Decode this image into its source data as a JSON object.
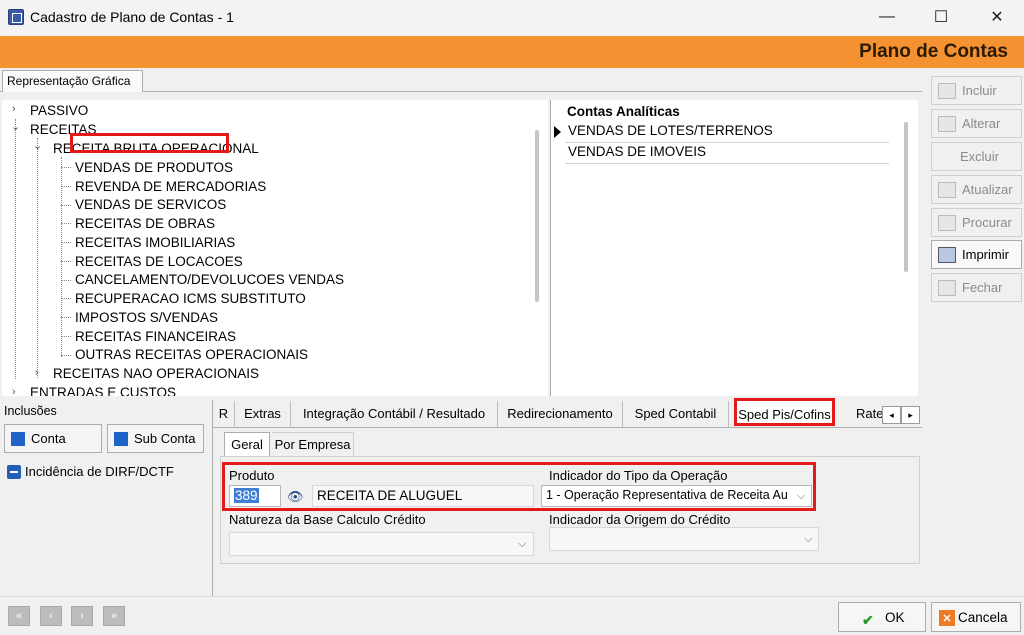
{
  "window": {
    "title": "Cadastro de Plano de Contas - 1",
    "minimize": "—",
    "maximize": "☐",
    "close": "✕"
  },
  "header": {
    "title": "Plano de Contas"
  },
  "top_tab": "Representação Gráfica",
  "tree": {
    "items": [
      {
        "label": "PASSIVO",
        "expander": "›"
      },
      {
        "label": "RECEITAS",
        "expander": "⌄"
      },
      {
        "label": "RECEITA BRUTA OPERACIONAL",
        "expander": "⌄"
      },
      {
        "label": "VENDAS DE PRODUTOS"
      },
      {
        "label": "REVENDA DE MERCADORIAS"
      },
      {
        "label": "VENDAS DE SERVICOS"
      },
      {
        "label": "RECEITAS DE OBRAS"
      },
      {
        "label": "RECEITAS IMOBILIARIAS"
      },
      {
        "label": "RECEITAS DE LOCACOES"
      },
      {
        "label": "CANCELAMENTO/DEVOLUCOES VENDAS"
      },
      {
        "label": "RECUPERACAO ICMS SUBSTITUTO"
      },
      {
        "label": "IMPOSTOS S/VENDAS"
      },
      {
        "label": "RECEITAS FINANCEIRAS"
      },
      {
        "label": "OUTRAS RECEITAS OPERACIONAIS"
      },
      {
        "label": "RECEITAS NAO OPERACIONAIS",
        "expander": "›"
      },
      {
        "label": "ENTRADAS E CUSTOS",
        "expander": "›"
      }
    ]
  },
  "grid": {
    "header": "Contas Analíticas",
    "rows": [
      "VENDAS DE LOTES/TERRENOS",
      "VENDAS DE IMOVEIS"
    ]
  },
  "side_buttons": [
    {
      "label": "Incluir",
      "enabled": false
    },
    {
      "label": "Alterar",
      "enabled": false
    },
    {
      "label": "Excluir",
      "enabled": false
    },
    {
      "label": "Atualizar",
      "enabled": false
    },
    {
      "label": "Procurar",
      "enabled": false
    },
    {
      "label": "Imprimir",
      "enabled": true
    },
    {
      "label": "Fechar",
      "enabled": false
    }
  ],
  "inclusoes": {
    "label": "Inclusões",
    "conta": "Conta",
    "subconta": "Sub Conta",
    "checkbox_label": "Incidência de DIRF/DCTF"
  },
  "tabs": [
    {
      "label": "R"
    },
    {
      "label": "Extras"
    },
    {
      "label": "Integração Contábil / Resultado"
    },
    {
      "label": "Redirecionamento"
    },
    {
      "label": "Sped Contabil"
    },
    {
      "label": "Sped Pis/Cofins",
      "active": true
    },
    {
      "label": "Rate"
    }
  ],
  "tab_arrows": {
    "left": "◂",
    "right": "▸"
  },
  "subtabs": {
    "geral": "Geral",
    "empresa": "Por Empresa"
  },
  "form": {
    "produto_label": "Produto",
    "produto_code": "389",
    "produto_desc": "RECEITA DE ALUGUEL",
    "indicador_tipo_label": "Indicador do Tipo da Operação",
    "indicador_tipo_value": "1 - Operação Representativa de Receita Au",
    "natureza_label": "Natureza da Base Calculo Crédito",
    "natureza_value": "",
    "indicador_origem_label": "Indicador da Origem do Crédito",
    "indicador_origem_value": ""
  },
  "footer": {
    "nav": [
      "«",
      "‹",
      "›",
      "»"
    ],
    "ok": "OK",
    "cancela": "Cancela",
    "ok_glyph": "✔",
    "cancel_glyph": "✕"
  }
}
